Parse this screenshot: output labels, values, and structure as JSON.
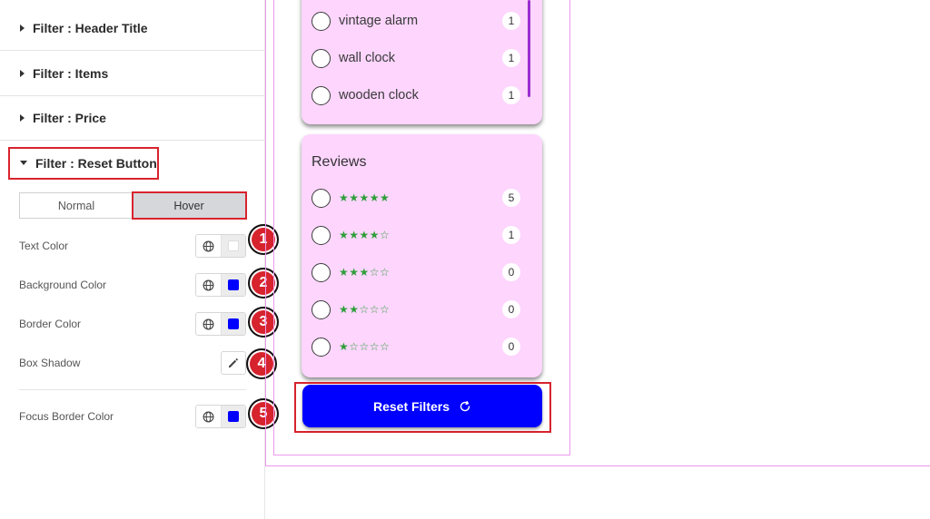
{
  "panel": {
    "sections": [
      {
        "title": "Filter : Header Title",
        "expanded": false
      },
      {
        "title": "Filter : Items",
        "expanded": false
      },
      {
        "title": "Filter : Price",
        "expanded": false
      },
      {
        "title": "Filter : Reset Button",
        "expanded": true
      }
    ],
    "tabs": {
      "normal": "Normal",
      "hover": "Hover",
      "active": "hover"
    },
    "controls": [
      {
        "label": "Text Color",
        "swatch": "#ffffff",
        "badge": "1"
      },
      {
        "label": "Background Color",
        "swatch": "#0000ff",
        "badge": "2"
      },
      {
        "label": "Border Color",
        "swatch": "#0000ff",
        "badge": "3"
      },
      {
        "label": "Box Shadow",
        "badge": "4"
      },
      {
        "label": "Focus Border Color",
        "swatch": "#0000ff",
        "badge": "5"
      }
    ]
  },
  "preview": {
    "items": [
      {
        "name": "vintage alarm",
        "count": "1"
      },
      {
        "name": "wall clock",
        "count": "1"
      },
      {
        "name": "wooden clock",
        "count": "1"
      }
    ],
    "reviews": {
      "title": "Reviews",
      "rows": [
        {
          "stars": "★★★★★",
          "count": "5"
        },
        {
          "stars": "★★★★☆",
          "count": "1"
        },
        {
          "stars": "★★★☆☆",
          "count": "0"
        },
        {
          "stars": "★★☆☆☆",
          "count": "0"
        },
        {
          "stars": "★☆☆☆☆",
          "count": "0"
        }
      ]
    },
    "reset_label": "Reset Filters"
  },
  "colors": {
    "accent_red": "#d6232d",
    "reset_blue": "#0000ff",
    "card_pink": "#fdd5fd",
    "star_green": "#2f9e3a",
    "scroll_purple": "#9b2fd0"
  }
}
